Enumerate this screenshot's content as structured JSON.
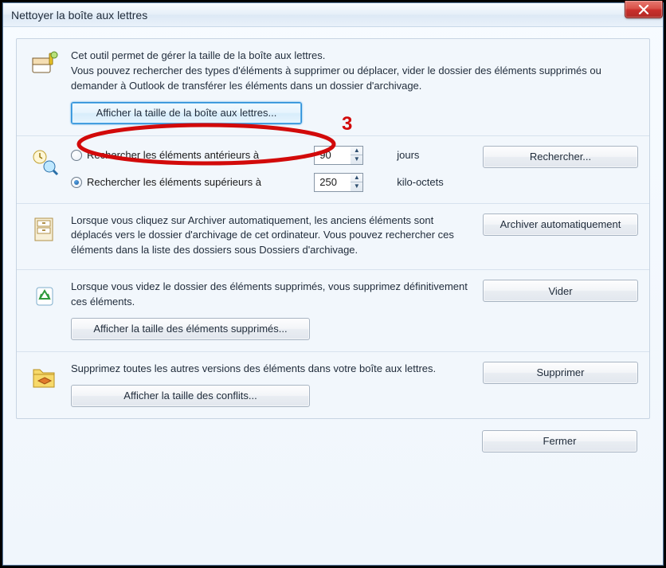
{
  "title": "Nettoyer la boîte aux lettres",
  "annotation_number": "3",
  "intro": {
    "line1": "Cet outil permet de gérer la taille de la boîte aux lettres.",
    "line2": "Vous pouvez rechercher des types d'éléments à supprimer ou déplacer, vider le dossier des éléments supprimés ou demander à Outlook de transférer les éléments dans un dossier d'archivage.",
    "button": "Afficher la taille de la boîte aux lettres..."
  },
  "search": {
    "opt_older": "Rechercher les éléments antérieurs à",
    "opt_larger": "Rechercher les éléments supérieurs à",
    "days_value": "90",
    "days_unit": "jours",
    "kb_value": "250",
    "kb_unit": "kilo-octets",
    "button": "Rechercher..."
  },
  "archive": {
    "desc": "Lorsque vous cliquez sur Archiver automatiquement, les anciens éléments sont déplacés vers le dossier d'archivage de cet ordinateur. Vous pouvez rechercher ces éléments dans la liste des dossiers sous Dossiers d'archivage.",
    "button": "Archiver automatiquement"
  },
  "empty": {
    "desc": "Lorsque vous videz le dossier des éléments supprimés, vous supprimez définitivement ces éléments.",
    "button": "Vider",
    "size_button": "Afficher la taille des éléments supprimés..."
  },
  "conflicts": {
    "desc": "Supprimez toutes les autres versions des éléments dans votre boîte aux lettres.",
    "button": "Supprimer",
    "size_button": "Afficher la taille des conflits..."
  },
  "close_button": "Fermer"
}
